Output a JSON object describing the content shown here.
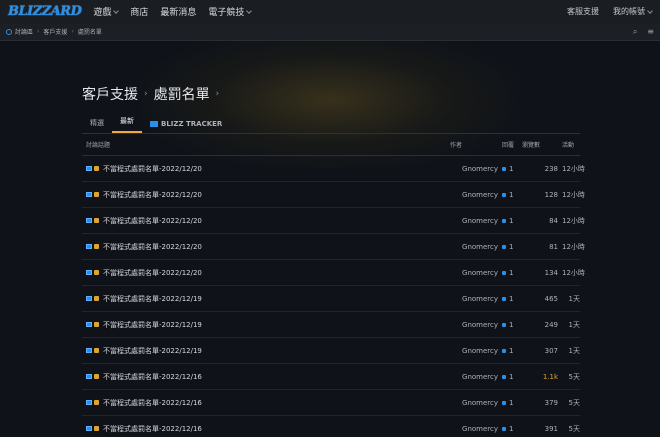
{
  "brand": {
    "logo_text": "BLIZZARD"
  },
  "nav": {
    "items": [
      {
        "label": "遊戲",
        "dropdown": true
      },
      {
        "label": "商店",
        "dropdown": false
      },
      {
        "label": "最新消息",
        "dropdown": false
      },
      {
        "label": "電子競技",
        "dropdown": true
      }
    ],
    "support_label": "客服支援",
    "account_label": "我的帳號"
  },
  "breadcrumb": [
    "討論區",
    "客戶支援",
    "處罰名單"
  ],
  "page": {
    "title_parent": "客戶支援",
    "title_current": "處罰名單"
  },
  "tabs": [
    {
      "label": "精選",
      "active": false
    },
    {
      "label": "最新",
      "active": true
    },
    {
      "label": "BLIZZ TRACKER",
      "active": false
    }
  ],
  "table": {
    "headers": {
      "topic": "討論話題",
      "author": "作者",
      "replies": "回覆",
      "views": "瀏覽數",
      "activity": "活動"
    },
    "rows": [
      {
        "title": "不當程式處罰名單-2022/12/20",
        "author": "Gnomercy",
        "replies": "1",
        "views": "238",
        "activity": "12小時"
      },
      {
        "title": "不當程式處罰名單-2022/12/20",
        "author": "Gnomercy",
        "replies": "1",
        "views": "128",
        "activity": "12小時"
      },
      {
        "title": "不當程式處罰名單-2022/12/20",
        "author": "Gnomercy",
        "replies": "1",
        "views": "84",
        "activity": "12小時"
      },
      {
        "title": "不當程式處罰名單-2022/12/20",
        "author": "Gnomercy",
        "replies": "1",
        "views": "81",
        "activity": "12小時"
      },
      {
        "title": "不當程式處罰名單-2022/12/20",
        "author": "Gnomercy",
        "replies": "1",
        "views": "134",
        "activity": "12小時"
      },
      {
        "title": "不當程式處罰名單-2022/12/19",
        "author": "Gnomercy",
        "replies": "1",
        "views": "465",
        "activity": "1天"
      },
      {
        "title": "不當程式處罰名單-2022/12/19",
        "author": "Gnomercy",
        "replies": "1",
        "views": "249",
        "activity": "1天"
      },
      {
        "title": "不當程式處罰名單-2022/12/19",
        "author": "Gnomercy",
        "replies": "1",
        "views": "307",
        "activity": "1天"
      },
      {
        "title": "不當程式處罰名單-2022/12/16",
        "author": "Gnomercy",
        "replies": "1",
        "views": "1.1k",
        "hot": true,
        "activity": "5天"
      },
      {
        "title": "不當程式處罰名單-2022/12/16",
        "author": "Gnomercy",
        "replies": "1",
        "views": "379",
        "activity": "5天"
      },
      {
        "title": "不當程式處罰名單-2022/12/16",
        "author": "Gnomercy",
        "replies": "1",
        "views": "391",
        "activity": "5天"
      }
    ]
  },
  "colors": {
    "accent": "#2a8fe6",
    "highlight": "#f0a93a",
    "background": "#0f1319"
  },
  "icons": {
    "search": "search-icon",
    "menu": "hamburger-menu-icon"
  }
}
